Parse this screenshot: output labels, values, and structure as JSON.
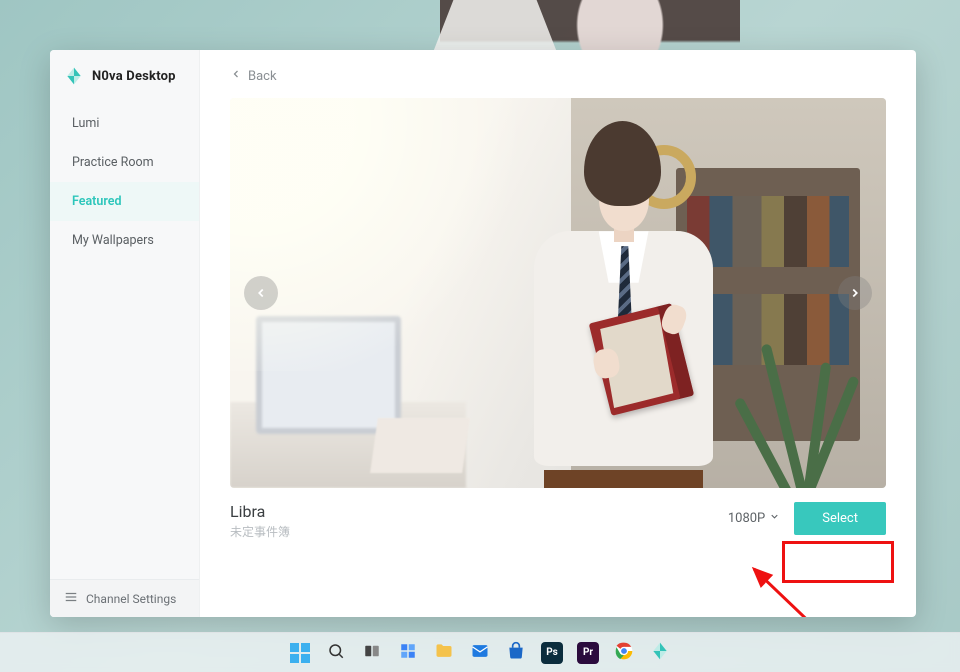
{
  "app": {
    "name": "N0va Desktop"
  },
  "sidebar": {
    "items": [
      {
        "label": "Lumi"
      },
      {
        "label": "Practice Room"
      },
      {
        "label": "Featured"
      },
      {
        "label": "My Wallpapers"
      }
    ],
    "channel_settings": "Channel Settings"
  },
  "main": {
    "back": "Back",
    "wallpaper": {
      "title": "Libra",
      "subtitle": "未定事件簿",
      "resolution": "1080P",
      "select": "Select"
    }
  },
  "taskbar": {
    "items": [
      {
        "name": "start",
        "label": ""
      },
      {
        "name": "search",
        "label": ""
      },
      {
        "name": "task-view",
        "label": ""
      },
      {
        "name": "widgets",
        "label": ""
      },
      {
        "name": "explorer",
        "label": ""
      },
      {
        "name": "mail",
        "label": ""
      },
      {
        "name": "store",
        "label": ""
      },
      {
        "name": "photoshop",
        "label": "Ps",
        "bg": "#0b2d3d"
      },
      {
        "name": "premiere",
        "label": "Pr",
        "bg": "#2b0b3d"
      },
      {
        "name": "chrome",
        "label": ""
      },
      {
        "name": "n0va",
        "label": ""
      }
    ]
  },
  "colors": {
    "accent": "#38c8bd"
  }
}
